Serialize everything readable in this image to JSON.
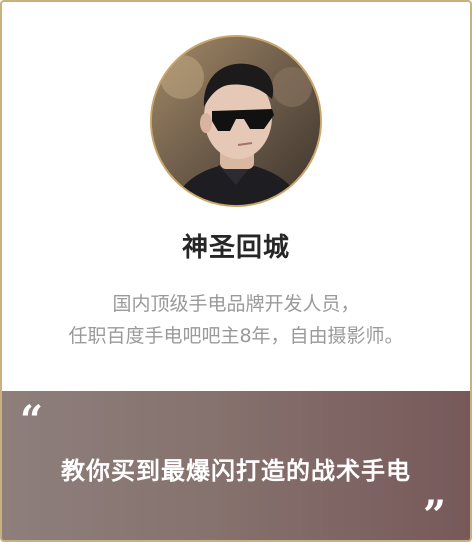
{
  "profile": {
    "avatar_icon": "person-avatar-photo",
    "name": "神圣回城",
    "bio_line1": "国内顶级手电品牌开发人员，",
    "bio_line2": "任职百度手电吧吧主8年，自由摄影师。"
  },
  "quote": {
    "open_mark": "“",
    "text": "教你买到最爆闪打造的战术手电",
    "close_mark": "”"
  },
  "colors": {
    "border": "#c9b07c",
    "name": "#262626",
    "bio": "#9a9a9a",
    "quote_bg_start": "#8e7f7c",
    "quote_bg_end": "#77595a",
    "quote_text": "#ffffff"
  }
}
